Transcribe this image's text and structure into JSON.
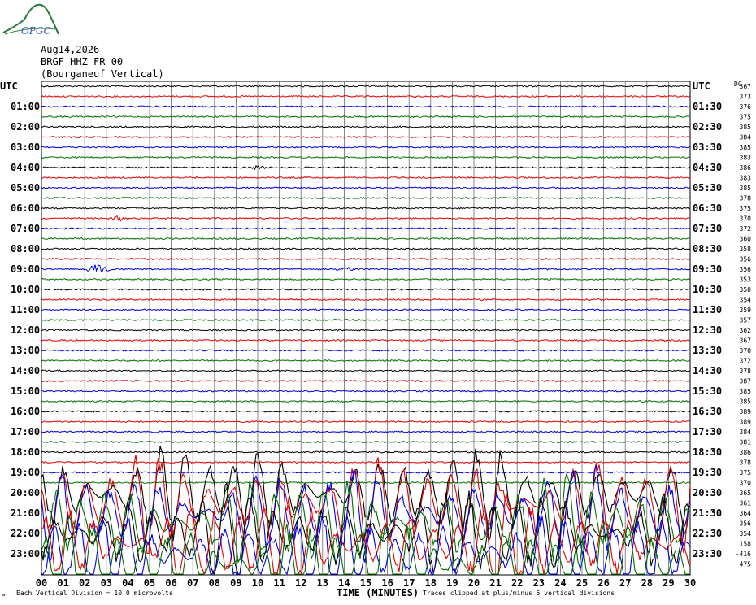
{
  "logo_text": "OPGC",
  "header": {
    "date": "Aug14,2026",
    "station": "BRGF HHZ FR 00",
    "location": "(Bourganeuf Vertical)"
  },
  "left_axis_title": "UTC",
  "right_axis_title": "UTC",
  "right_column_title": "DC",
  "footer": {
    "division_note": "Each Vertical Division = 10.0 microvolts",
    "xlabel": "TIME (MINUTES)",
    "clip_note": "Traces clipped at plus/minus 5 vertical divisions",
    "mark": "»"
  },
  "chart_data": {
    "type": "line",
    "title": "BRGF HHZ FR 00 (Bourganeuf Vertical)",
    "xlabel": "TIME (MINUTES)",
    "ylabel": "UTC",
    "x_range": [
      0,
      30
    ],
    "x_ticks": [
      "00",
      "01",
      "02",
      "03",
      "04",
      "05",
      "06",
      "07",
      "08",
      "09",
      "10",
      "11",
      "12",
      "13",
      "14",
      "15",
      "16",
      "17",
      "18",
      "19",
      "20",
      "21",
      "22",
      "23",
      "24",
      "25",
      "26",
      "27",
      "28",
      "29",
      "30"
    ],
    "left_hour_labels": [
      "UTC",
      "",
      "01:00",
      "",
      "02:00",
      "",
      "03:00",
      "",
      "04:00",
      "",
      "05:00",
      "",
      "06:00",
      "",
      "07:00",
      "",
      "08:00",
      "",
      "09:00",
      "",
      "10:00",
      "",
      "11:00",
      "",
      "12:00",
      "",
      "13:00",
      "",
      "14:00",
      "",
      "15:00",
      "",
      "16:00",
      "",
      "17:00",
      "",
      "18:00",
      "",
      "19:00",
      "",
      "20:00",
      "",
      "21:00",
      "",
      "22:00",
      "",
      "23:00",
      ""
    ],
    "right_hour_labels": [
      "UTC",
      "",
      "01:30",
      "",
      "02:30",
      "",
      "03:30",
      "",
      "04:30",
      "",
      "05:30",
      "",
      "06:30",
      "",
      "07:30",
      "",
      "08:30",
      "",
      "09:30",
      "",
      "10:30",
      "",
      "11:30",
      "",
      "12:30",
      "",
      "13:30",
      "",
      "14:30",
      "",
      "15:30",
      "",
      "16:30",
      "",
      "17:30",
      "",
      "18:30",
      "",
      "19:30",
      "",
      "20:30",
      "",
      "21:30",
      "",
      "22:30",
      "",
      "23:30",
      ""
    ],
    "dc_offsets": [
      "367",
      "373",
      "376",
      "375",
      "385",
      "384",
      "385",
      "383",
      "386",
      "383",
      "385",
      "378",
      "375",
      "370",
      "372",
      "360",
      "358",
      "356",
      "356",
      "353",
      "350",
      "354",
      "359",
      "357",
      "362",
      "367",
      "370",
      "372",
      "378",
      "387",
      "385",
      "385",
      "389",
      "389",
      "384",
      "381",
      "386",
      "378",
      "375",
      "370",
      "365",
      "361",
      "364",
      "356",
      "354",
      "158",
      "-416",
      "475"
    ],
    "trace_colors": [
      "#000000",
      "#e00000",
      "#0000e0",
      "#007000"
    ],
    "grid": true,
    "events": [
      {
        "trace": 8,
        "minute": 10.0,
        "amplitude": 3
      },
      {
        "trace": 13,
        "minute": 3.5,
        "amplitude": 3
      },
      {
        "trace": 18,
        "minute": 2.6,
        "amplitude": 7
      },
      {
        "trace": 18,
        "minute": 14.0,
        "amplitude": 3
      }
    ],
    "clipped_from_trace": 40
  }
}
